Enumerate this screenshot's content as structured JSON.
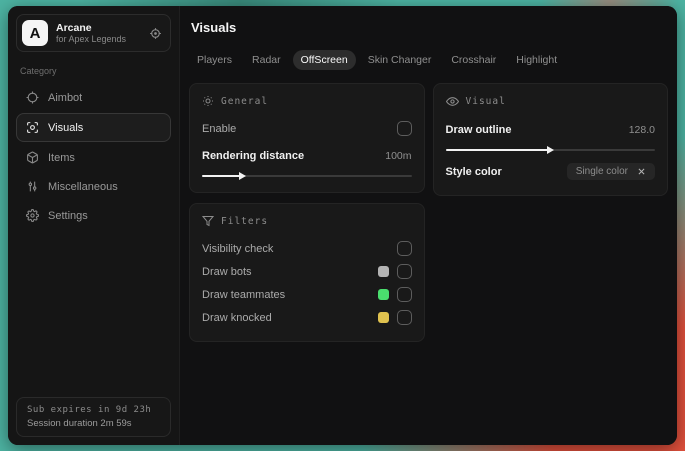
{
  "colors": {
    "bg_teal": "#4db3a2",
    "bg_red": "#e0503c",
    "swatch_bots": "#b3b3b3",
    "swatch_teammates": "#4ade6e",
    "swatch_knocked": "#e0c24f"
  },
  "sidebar": {
    "logo_letter": "A",
    "app_name": "Arcane",
    "app_subtitle": "for Apex Legends",
    "category_label": "Category",
    "items": [
      {
        "label": "Aimbot"
      },
      {
        "label": "Visuals"
      },
      {
        "label": "Items"
      },
      {
        "label": "Miscellaneous"
      },
      {
        "label": "Settings"
      }
    ],
    "footer": {
      "line1": "Sub expires in 9d 23h",
      "line2": "Session duration 2m 59s"
    }
  },
  "main": {
    "title": "Visuals",
    "tabs": [
      {
        "label": "Players"
      },
      {
        "label": "Radar"
      },
      {
        "label": "OffScreen"
      },
      {
        "label": "Skin Changer"
      },
      {
        "label": "Crosshair"
      },
      {
        "label": "Highlight"
      }
    ],
    "general": {
      "title": "General",
      "enable_label": "Enable",
      "rendering_label": "Rendering distance",
      "rendering_value": "100m",
      "rendering_fill_percent": 20
    },
    "filters": {
      "title": "Filters",
      "visibility_label": "Visibility check",
      "bots_label": "Draw bots",
      "teammates_label": "Draw teammates",
      "knocked_label": "Draw knocked"
    },
    "visual": {
      "title": "Visual",
      "outline_label": "Draw outline",
      "outline_value": "128.0",
      "outline_fill_percent": 51,
      "style_label": "Style color",
      "style_value": "Single color"
    }
  }
}
